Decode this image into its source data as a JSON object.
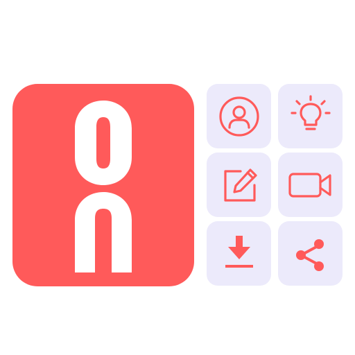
{
  "colors": {
    "accent": "#FF5A5A",
    "tile_bg": "#ECEAFB",
    "logo_glyph": "#FFFFFF"
  },
  "app_icon": {
    "icon": "on-logo-icon"
  },
  "action_tiles": [
    {
      "id": "profile",
      "icon": "user-profile-icon"
    },
    {
      "id": "idea",
      "icon": "lightbulb-icon"
    },
    {
      "id": "edit",
      "icon": "edit-note-icon"
    },
    {
      "id": "video",
      "icon": "video-camera-icon"
    },
    {
      "id": "download",
      "icon": "download-icon"
    },
    {
      "id": "share",
      "icon": "share-icon"
    }
  ]
}
